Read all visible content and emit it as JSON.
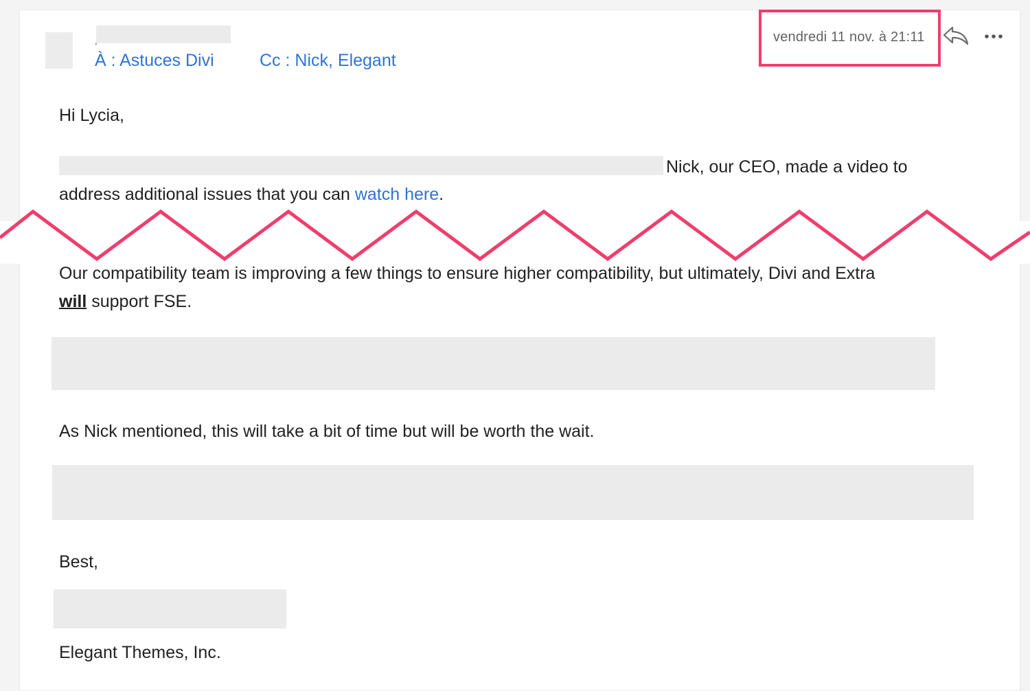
{
  "header": {
    "recipients_to": "À : Astuces Divi",
    "recipients_cc": "Cc : Nick, Elegant",
    "date": "vendredi 11 nov. à 21:11",
    "sender_tick": ","
  },
  "icons": {
    "reply": "reply-icon",
    "more": "more-options-icon",
    "zigzag": "zigzag-break"
  },
  "colors": {
    "highlight": "#ee3e6d",
    "link": "#2f73d6",
    "redaction": "#ebebeb"
  },
  "body": {
    "greeting": "Hi Lycia,",
    "para1_line1_tail": "Nick, our CEO, made a video to",
    "para1_line2_prefix": "address additional issues that you can ",
    "para1_link": "watch here",
    "para1_line2_suffix": ".",
    "para2_line1": "Our compatibility team is improving a few things to ensure higher compatibility, but ultimately, Divi and Extra",
    "para2_bold": "will",
    "para2_line2_suffix": " support FSE.",
    "para3": "As Nick mentioned, this will take a bit of time but will be worth the wait.",
    "signoff": "Best,",
    "company": "Elegant Themes, Inc."
  }
}
